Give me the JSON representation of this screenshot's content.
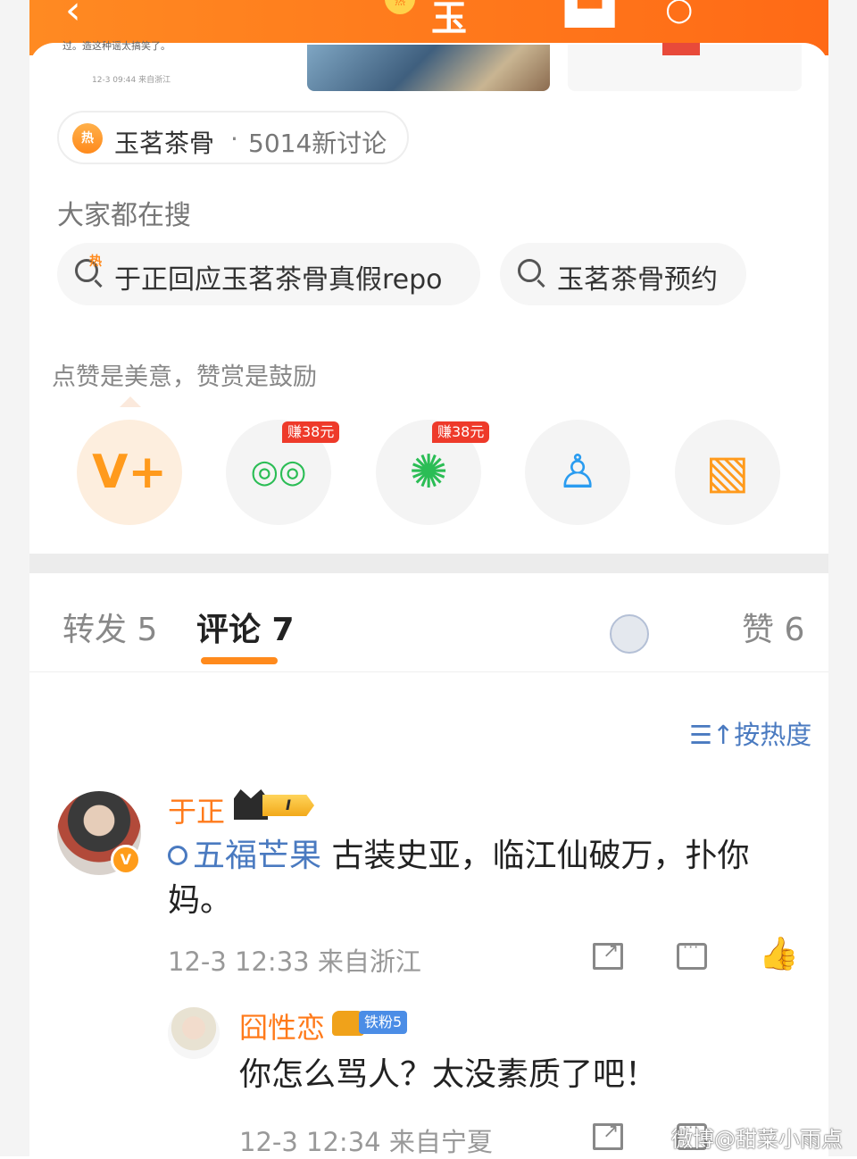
{
  "top_bar": {
    "back_glyph": "‹",
    "title_partial": "玉",
    "badge_text": "热"
  },
  "snippet": {
    "text": "过。造这种谣太搞笑了。",
    "meta": "12-3 09:44 来自浙江"
  },
  "topic_chip": {
    "hot_icon": "热",
    "name": "玉茗茶骨",
    "separator": "·",
    "count_text": "5014新讨论"
  },
  "search_section": {
    "title": "大家都在搜",
    "items": [
      {
        "label": "于正回应玉茗茶骨真假repo",
        "icon": "hot-search-icon"
      },
      {
        "label": "玉茗茶骨预约",
        "icon": "search-icon"
      }
    ]
  },
  "reward_tip": "点赞是美意，赞赏是鼓励",
  "share_buttons": [
    {
      "icon": "vplus-reward-icon",
      "glyph": "V+",
      "color": "#ff9a1c",
      "earn": ""
    },
    {
      "icon": "wechat-icon",
      "glyph": "◎◎",
      "color": "#2bbd55",
      "earn": "赚38元"
    },
    {
      "icon": "moments-icon",
      "glyph": "✺",
      "color": "#2bbd55",
      "earn": "赚38元"
    },
    {
      "icon": "qq-icon",
      "glyph": "♙",
      "color": "#2a9cf0",
      "earn": ""
    },
    {
      "icon": "save-image-icon",
      "glyph": "▧",
      "color": "#ff9a1c",
      "earn": ""
    }
  ],
  "tabs": [
    {
      "label": "转发 5",
      "active": false
    },
    {
      "label": "评论 7",
      "active": true
    },
    {
      "label": "赞 6",
      "active": false
    }
  ],
  "sort_label": "按热度",
  "comments": [
    {
      "user": "于正",
      "level": "I",
      "verified_badge": "V",
      "topic_link": "五福芒果",
      "text": " 古装史亚，临江仙破万，扑你妈。",
      "meta": "12-3 12:33 来自浙江"
    },
    {
      "user": "囧性恋",
      "fan_badge": "铁粉5",
      "text": "你怎么骂人？太没素质了吧！",
      "meta": "12-3 12:34 来自宁夏"
    }
  ],
  "watermark": "微博@甜菜小雨点"
}
